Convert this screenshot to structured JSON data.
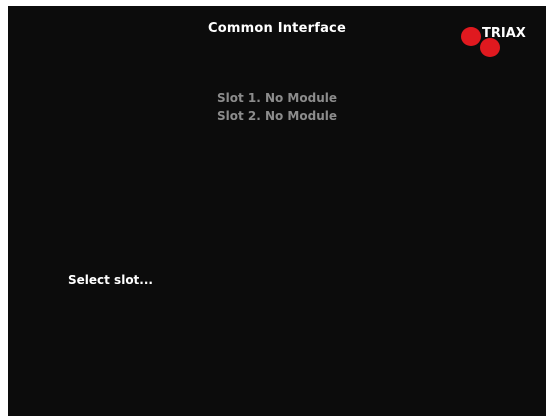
{
  "menu": {
    "title": "Common Interface",
    "brand": "TRIAX",
    "slots": [
      "Slot 1. No Module",
      "Slot 2. No Module"
    ],
    "hint": "Select slot..."
  },
  "colors": {
    "background": "#0c0c0c",
    "title_text": "#ffffff",
    "slot_text": "#8c8c8c",
    "brand_dot": "#e0191f"
  }
}
